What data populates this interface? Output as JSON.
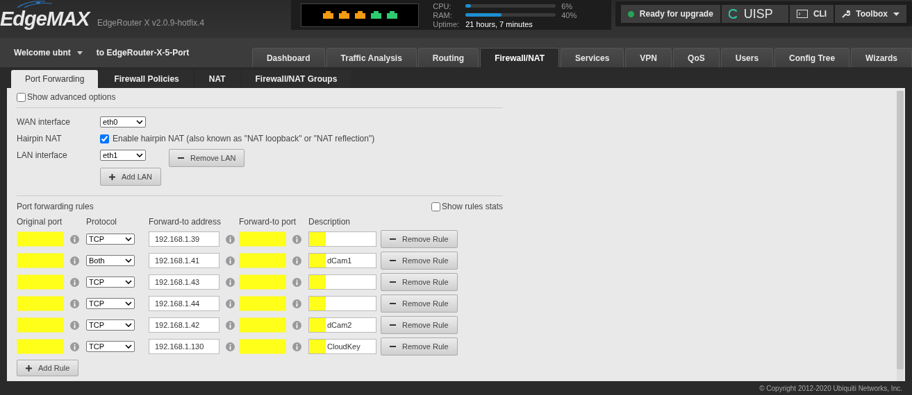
{
  "header": {
    "logo": "EdgeMAX",
    "version": "EdgeRouter X v2.0.9-hotfix.4",
    "ports": [
      {
        "color": "#f39c12"
      },
      {
        "color": "#f39c12"
      },
      {
        "color": "#f39c12"
      },
      {
        "color": "#2ecc71"
      },
      {
        "color": "#2ecc71"
      }
    ],
    "stats": [
      {
        "label": "CPU:",
        "level": 0.06,
        "reading": "6%"
      },
      {
        "label": "RAM:",
        "level": 0.4,
        "reading": "40%"
      }
    ],
    "uptime": {
      "label": "Uptime:",
      "value": "21 hours, 7 minutes"
    },
    "actions": [
      {
        "kind": "status",
        "label": "Ready for upgrade"
      },
      {
        "kind": "uisp",
        "label": "UISP"
      },
      {
        "kind": "cli",
        "label": "CLI"
      },
      {
        "kind": "toolbox",
        "label": "Toolbox"
      }
    ]
  },
  "user": {
    "welcome": "Welcome ubnt",
    "device": "to EdgeRouter-X-5-Port"
  },
  "tabs": [
    {
      "label": "Dashboard",
      "selected": false
    },
    {
      "label": "Traffic Analysis",
      "selected": false
    },
    {
      "label": "Routing",
      "selected": false
    },
    {
      "label": "Firewall/NAT",
      "selected": true
    },
    {
      "label": "Services",
      "selected": false
    },
    {
      "label": "VPN",
      "selected": false
    },
    {
      "label": "QoS",
      "selected": false
    },
    {
      "label": "Users",
      "selected": false
    },
    {
      "label": "Config Tree",
      "selected": false
    },
    {
      "label": "Wizards",
      "selected": false
    }
  ],
  "subtabs": [
    {
      "label": "Port Forwarding",
      "selected": true
    },
    {
      "label": "Firewall Policies",
      "selected": false
    },
    {
      "label": "NAT",
      "selected": false
    },
    {
      "label": "Firewall/NAT Groups",
      "selected": false
    }
  ],
  "advanced": {
    "label": "Show advanced options",
    "checked": false
  },
  "wan": {
    "label": "WAN interface",
    "value": "eth0"
  },
  "hairpin": {
    "label": "Hairpin NAT",
    "text": "Enable hairpin NAT (also known as \"NAT loopback\" or \"NAT reflection\")",
    "checked": true
  },
  "lan": {
    "label": "LAN interface",
    "value": "eth1",
    "remove": "Remove LAN",
    "add": "Add LAN"
  },
  "rules": {
    "title": "Port forwarding rules",
    "stats": {
      "label": "Show rules stats",
      "checked": false
    },
    "columns": [
      "Original port",
      "Protocol",
      "Forward-to address",
      "Forward-to port",
      "Description"
    ],
    "rows": [
      {
        "protocol": "TCP",
        "address": "192.168.1.39",
        "remove": "Remove Rule"
      },
      {
        "protocol": "Both",
        "address": "192.168.1.41",
        "description": "dCam1",
        "remove": "Remove Rule"
      },
      {
        "protocol": "TCP",
        "address": "192.168.1.43",
        "remove": "Remove Rule"
      },
      {
        "protocol": "TCP",
        "address": "192.168.1.44",
        "remove": "Remove Rule"
      },
      {
        "protocol": "TCP",
        "address": "192.168.1.42",
        "description": "dCam2",
        "remove": "Remove Rule"
      },
      {
        "protocol": "TCP",
        "address": "192.168.1.130",
        "description": "CloudKey",
        "remove": "Remove Rule"
      }
    ],
    "add": "Add Rule"
  },
  "footer": "© Copyright 2012-2020 Ubiquiti Networks, Inc."
}
